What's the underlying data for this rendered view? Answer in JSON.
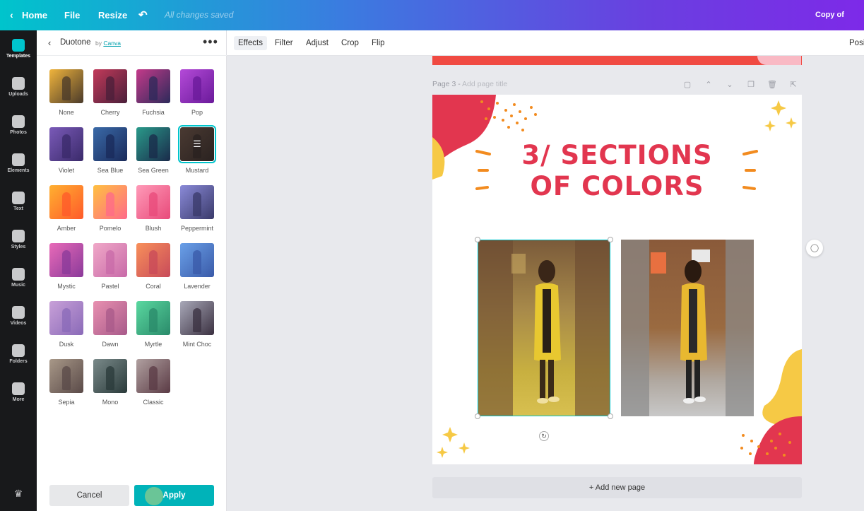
{
  "topbar": {
    "home": "Home",
    "file": "File",
    "resize": "Resize",
    "saved_status": "All changes saved",
    "doc_title": "Copy of Untitl"
  },
  "rail": [
    {
      "label": "Templates",
      "icon": "templates-icon",
      "active": true
    },
    {
      "label": "Uploads",
      "icon": "upload-icon"
    },
    {
      "label": "Photos",
      "icon": "photos-icon"
    },
    {
      "label": "Elements",
      "icon": "elements-icon"
    },
    {
      "label": "Text",
      "icon": "text-icon"
    },
    {
      "label": "Styles",
      "icon": "styles-icon"
    },
    {
      "label": "Music",
      "icon": "music-icon"
    },
    {
      "label": "Videos",
      "icon": "videos-icon"
    },
    {
      "label": "Folders",
      "icon": "folder-icon"
    },
    {
      "label": "More",
      "icon": "more-icon"
    }
  ],
  "panel": {
    "title": "Duotone",
    "by": "by",
    "by_link": "Canva",
    "cancel": "Cancel",
    "apply": "Apply",
    "effects": [
      {
        "label": "None",
        "c1": "#f0b43c",
        "c2": "#4a3a2a"
      },
      {
        "label": "Cherry",
        "c1": "#c23a5a",
        "c2": "#4a1f3a"
      },
      {
        "label": "Fuchsia",
        "c1": "#c43a8a",
        "c2": "#2c2a5a"
      },
      {
        "label": "Pop",
        "c1": "#b44ad8",
        "c2": "#6a1a9a"
      },
      {
        "label": "Violet",
        "c1": "#7a5ab8",
        "c2": "#3a2a6a"
      },
      {
        "label": "Sea Blue",
        "c1": "#3a6aa8",
        "c2": "#1a2a5a"
      },
      {
        "label": "Sea Green",
        "c1": "#2a9a8a",
        "c2": "#1a2a4a"
      },
      {
        "label": "Mustard",
        "c1": "#4a3a32",
        "c2": "#2a2220",
        "selected": true
      },
      {
        "label": "Amber",
        "c1": "#ffb030",
        "c2": "#ff5a2a"
      },
      {
        "label": "Pomelo",
        "c1": "#ffc040",
        "c2": "#ff6a8a"
      },
      {
        "label": "Blush",
        "c1": "#ff9ab8",
        "c2": "#e84a7a"
      },
      {
        "label": "Peppermint",
        "c1": "#8a8ad8",
        "c2": "#3a3a6a"
      },
      {
        "label": "Mystic",
        "c1": "#e86ab8",
        "c2": "#8a3a9a"
      },
      {
        "label": "Pastel",
        "c1": "#f0a8c8",
        "c2": "#c86aa8"
      },
      {
        "label": "Coral",
        "c1": "#f8905a",
        "c2": "#c84a5a"
      },
      {
        "label": "Lavender",
        "c1": "#6aa0e8",
        "c2": "#3a5aa8"
      },
      {
        "label": "Dusk",
        "c1": "#c8a0d8",
        "c2": "#8a6ab8"
      },
      {
        "label": "Dawn",
        "c1": "#e890b0",
        "c2": "#a85a8a"
      },
      {
        "label": "Myrtle",
        "c1": "#5ad8a0",
        "c2": "#2a8a6a"
      },
      {
        "label": "Mint Choc",
        "c1": "#a8a8b8",
        "c2": "#3a3040"
      },
      {
        "label": "Sepia",
        "c1": "#a89888",
        "c2": "#5a4a48"
      },
      {
        "label": "Mono",
        "c1": "#7a8a8a",
        "c2": "#2a3a3a"
      },
      {
        "label": "Classic",
        "c1": "#b0a0a0",
        "c2": "#5a3a44"
      }
    ]
  },
  "toolbar": {
    "effects": "Effects",
    "filter": "Filter",
    "adjust": "Adjust",
    "crop": "Crop",
    "flip": "Flip",
    "position": "Posi"
  },
  "page": {
    "label": "Page 3 - ",
    "title_placeholder": "Add page title",
    "headline_line1": "3/ SECTIONS",
    "headline_line2": "OF COLORS",
    "add_page": "+ Add new page"
  },
  "colors": {
    "accent": "#00c4cc",
    "headline": "#e2364f",
    "selection": "#00c4cc"
  }
}
